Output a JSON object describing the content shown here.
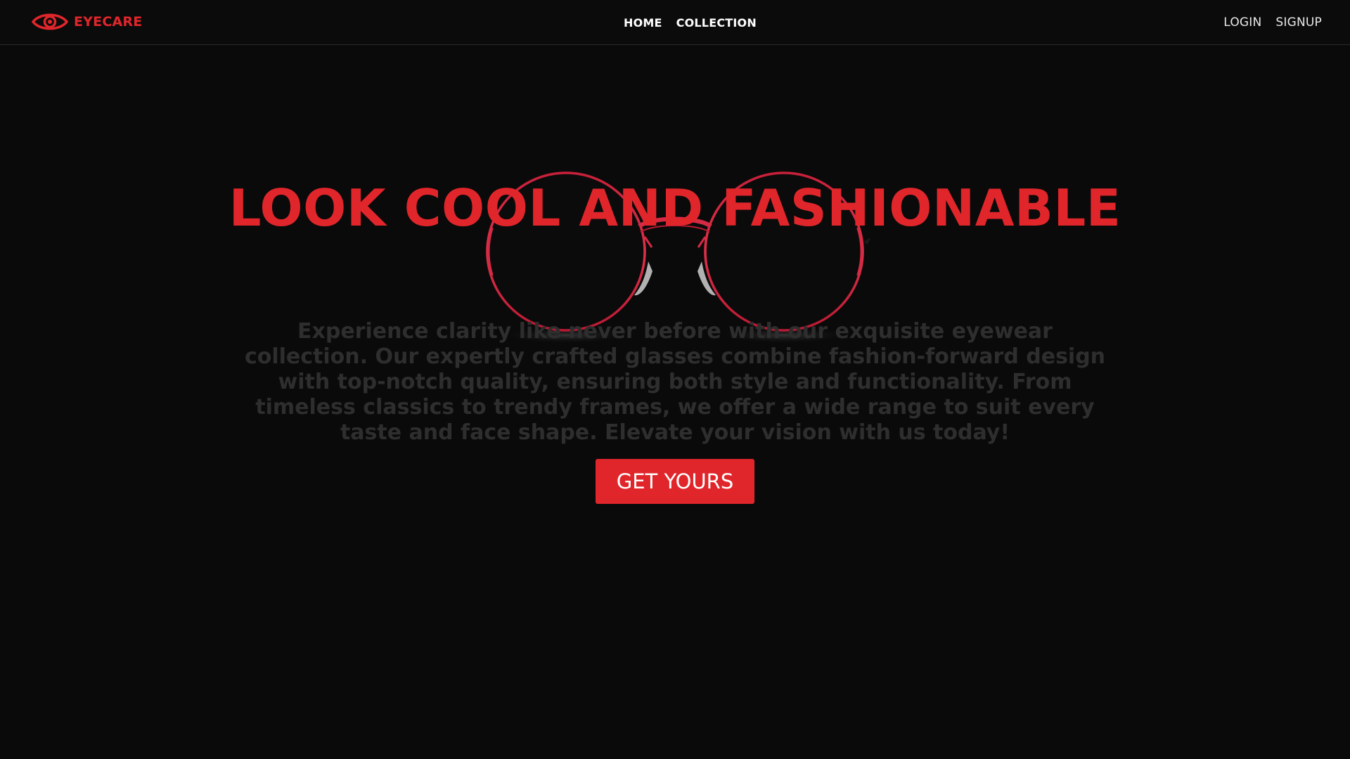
{
  "brand": {
    "name": "EYECARE",
    "icon": "eye-icon",
    "color": "#e0262b"
  },
  "nav": {
    "center": [
      {
        "label": "HOME"
      },
      {
        "label": "COLLECTION"
      }
    ],
    "right": [
      {
        "label": "LOGIN"
      },
      {
        "label": "SIGNUP"
      }
    ]
  },
  "hero": {
    "title": "LOOK COOL AND FASHIONABLE",
    "description": "Experience clarity like never before with our exquisite eyewear collection. Our expertly crafted glasses combine fashion-forward design with top-notch quality, ensuring both style and functionality. From timeless classics to trendy frames, we offer a wide range to suit every taste and face shape. Elevate your vision with us today!",
    "cta_label": "GET YOURS",
    "image": "round-glasses-image"
  },
  "colors": {
    "background": "#0a0a0a",
    "accent": "#e0262b",
    "description_text": "#2e2e2e"
  }
}
